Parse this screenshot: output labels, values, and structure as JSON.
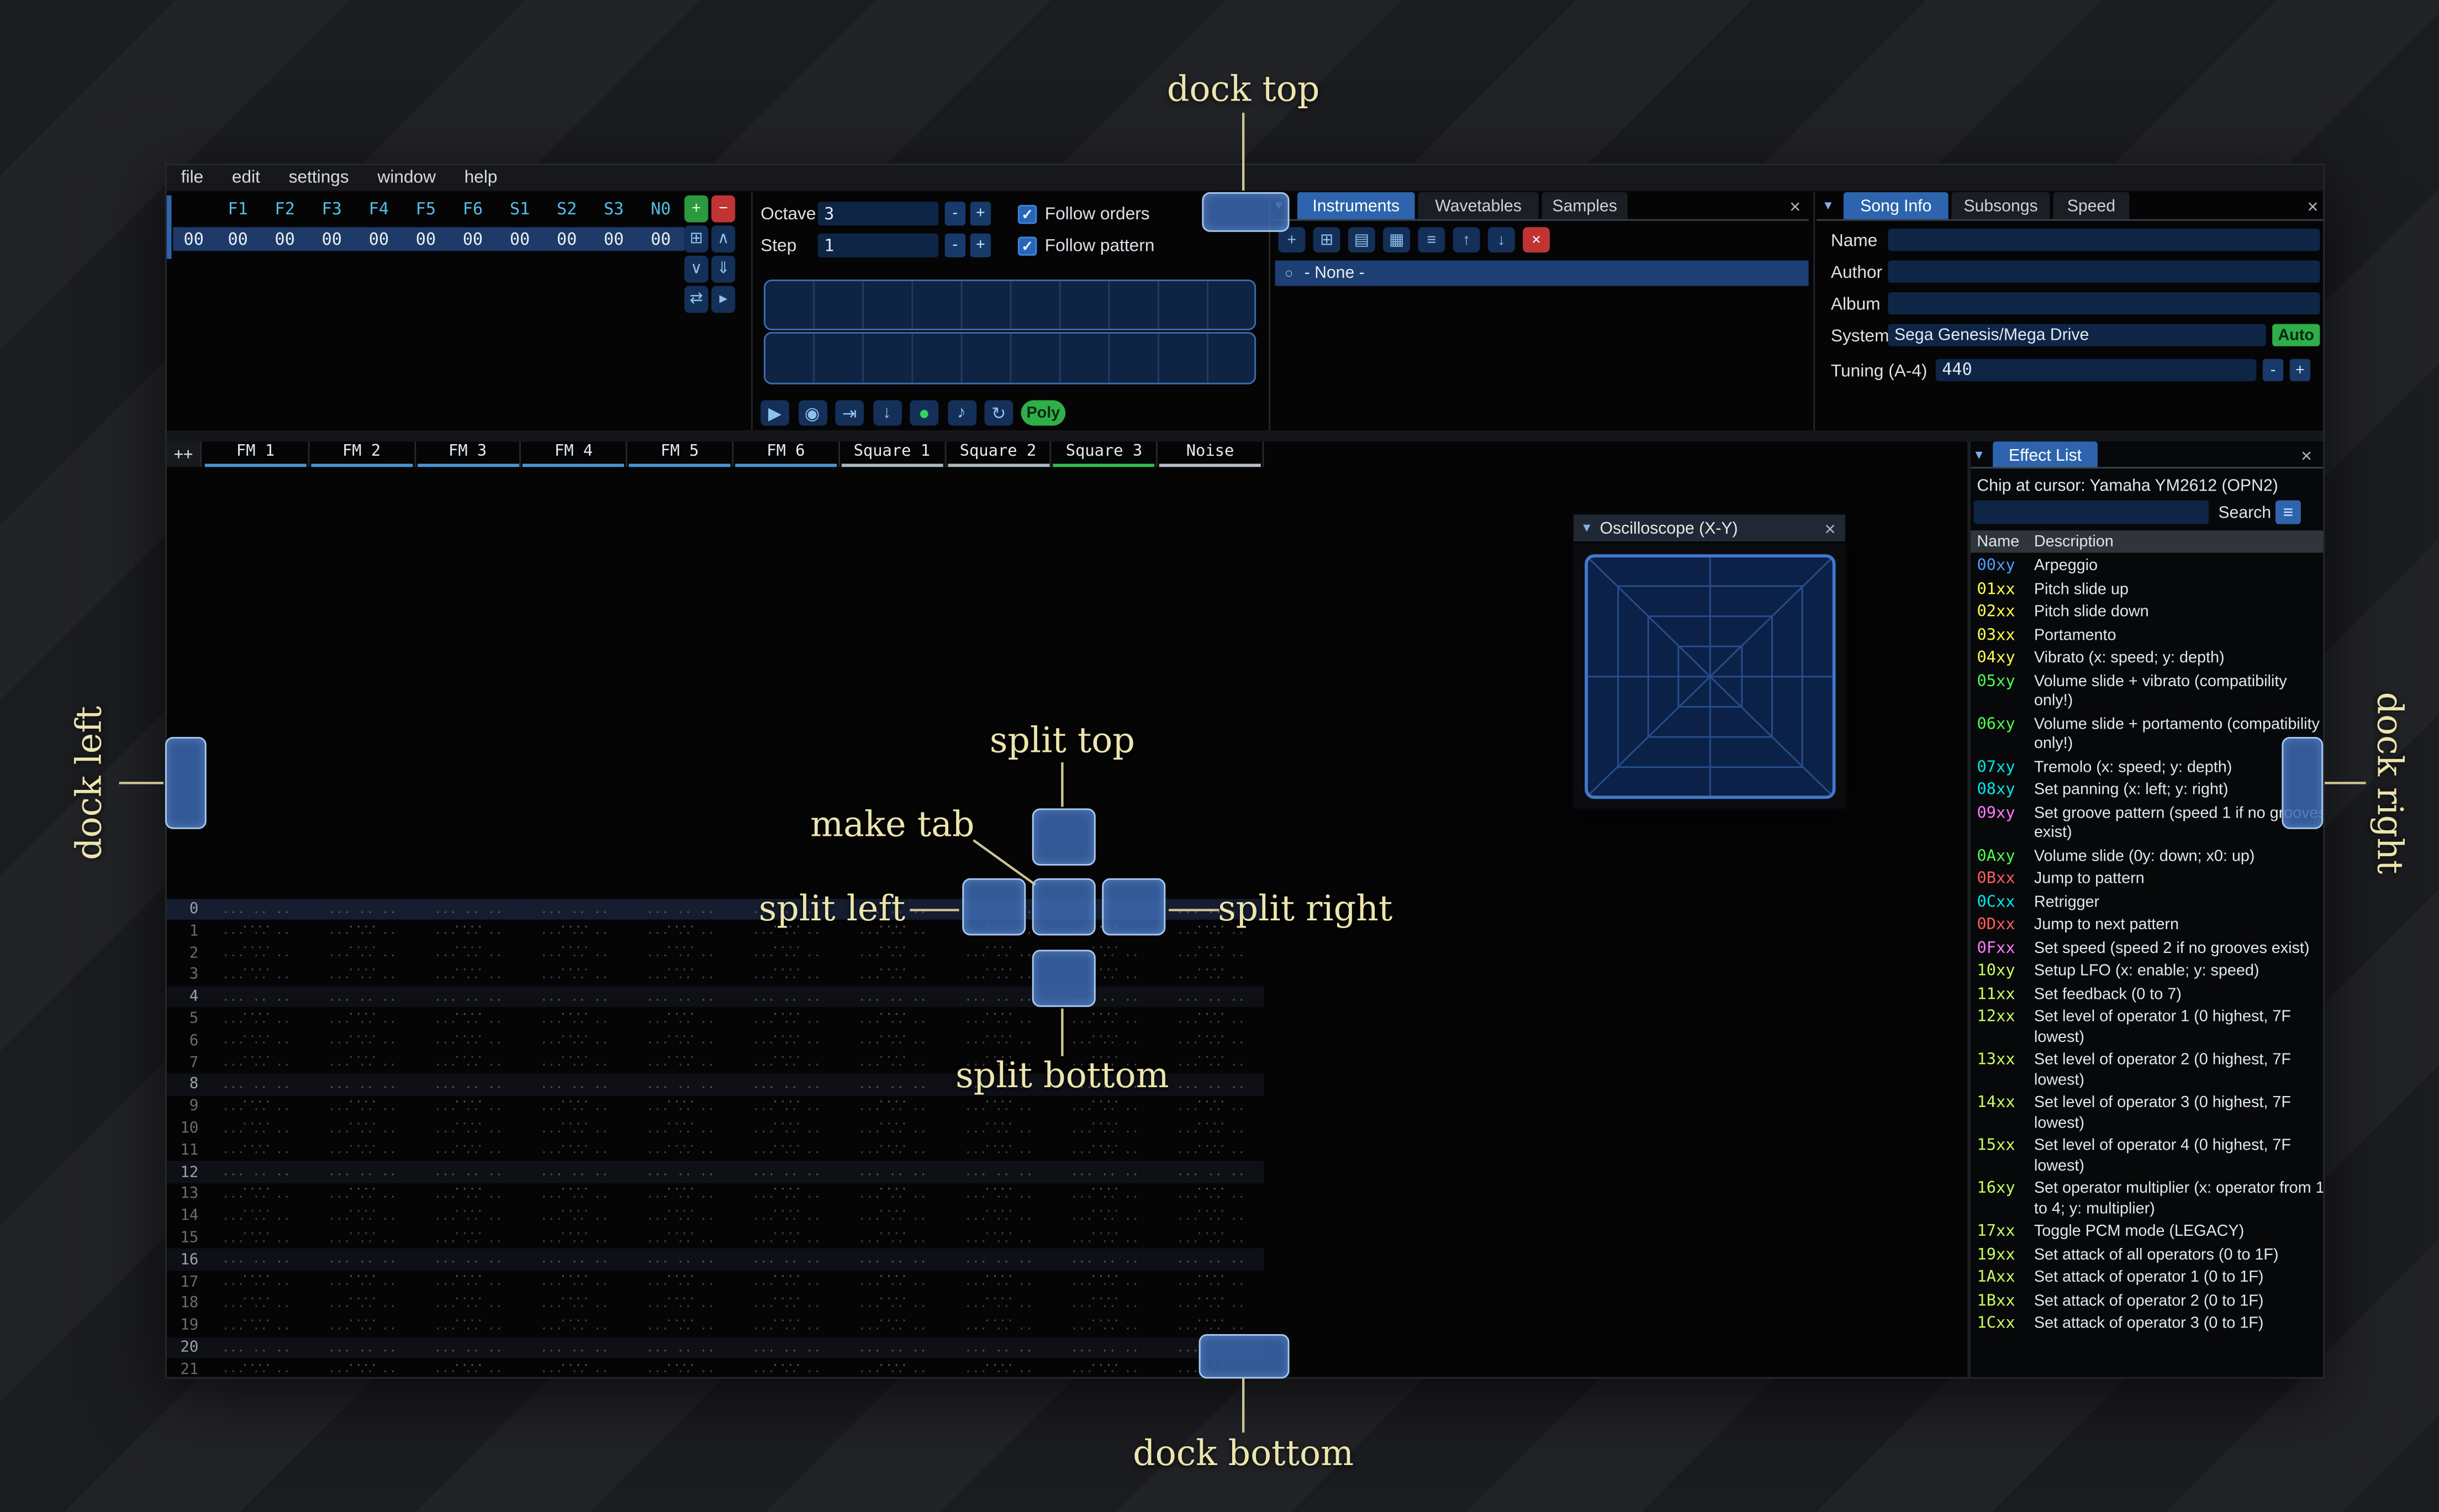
{
  "colors": {
    "accent": "#2d64ad",
    "overlay_label": "#ece5ad",
    "dock_fill": "#3c6ab2",
    "dock_border": "#a9c9f3"
  },
  "icons": {
    "check": "✓",
    "close": "×",
    "collapse": "▾",
    "radio": "○",
    "burger": "≡"
  },
  "menu": {
    "items": [
      "file",
      "edit",
      "settings",
      "window",
      "help"
    ]
  },
  "orders": {
    "row_index": "00",
    "columns": [
      "F1",
      "F2",
      "F3",
      "F4",
      "F5",
      "F6",
      "S1",
      "S2",
      "S3",
      "N0"
    ],
    "values": [
      "00",
      "00",
      "00",
      "00",
      "00",
      "00",
      "00",
      "00",
      "00",
      "00"
    ],
    "buttons": [
      {
        "name": "add-order",
        "glyph": "+",
        "style": "green"
      },
      {
        "name": "remove-order",
        "glyph": "−",
        "style": "red"
      },
      {
        "name": "duplicate-order",
        "glyph": "⊞",
        "style": "blue"
      },
      {
        "name": "move-order-up",
        "glyph": "∧",
        "style": "blue"
      },
      {
        "name": "move-order-down",
        "glyph": "∨",
        "style": "blue"
      },
      {
        "name": "duplicate-order-to-end",
        "glyph": "⇓",
        "style": "blue"
      },
      {
        "name": "order-change-all",
        "glyph": "⇄",
        "style": "blue"
      },
      {
        "name": "order-edit-mode",
        "glyph": "▸",
        "style": "blue"
      }
    ]
  },
  "controls": {
    "octave_label": "Octave",
    "octave_value": "3",
    "step_label": "Step",
    "step_value": "1",
    "minus": "-",
    "plus": "+",
    "follow_orders": "Follow orders",
    "follow_pattern": "Follow pattern",
    "play_buttons": [
      {
        "name": "play",
        "glyph": "▶"
      },
      {
        "name": "play-pattern",
        "glyph": "◉"
      },
      {
        "name": "play-from-cursor",
        "glyph": "⇥"
      },
      {
        "name": "step-one-row",
        "glyph": "↓"
      },
      {
        "name": "record",
        "glyph": "●",
        "style": "record"
      },
      {
        "name": "metronome",
        "glyph": "♪"
      },
      {
        "name": "repeat-pattern",
        "glyph": "↻"
      }
    ],
    "poly_label": "Poly"
  },
  "instrument_panel": {
    "tabs": [
      {
        "label": "Instruments",
        "active": true
      },
      {
        "label": "Wavetables",
        "active": false
      },
      {
        "label": "Samples",
        "active": false
      }
    ],
    "toolbar": [
      {
        "name": "add-instrument",
        "glyph": "+",
        "style": "blue"
      },
      {
        "name": "duplicate-instrument",
        "glyph": "⊞",
        "style": "blue"
      },
      {
        "name": "open-instrument",
        "glyph": "▤",
        "style": "blue"
      },
      {
        "name": "save-instrument",
        "glyph": "▦",
        "style": "blue"
      },
      {
        "name": "instrument-directory",
        "glyph": "≡",
        "style": "blue"
      },
      {
        "name": "move-instrument-up",
        "glyph": "↑",
        "style": "blue"
      },
      {
        "name": "move-instrument-down",
        "glyph": "↓",
        "style": "blue"
      },
      {
        "name": "delete-instrument",
        "glyph": "×",
        "style": "red"
      }
    ],
    "list_item": "- None -"
  },
  "song_info": {
    "tabs": [
      {
        "label": "Song Info",
        "active": true
      },
      {
        "label": "Subsongs",
        "active": false
      },
      {
        "label": "Speed",
        "active": false
      }
    ],
    "name_label": "Name",
    "name_value": "",
    "author_label": "Author",
    "author_value": "",
    "album_label": "Album",
    "album_value": "",
    "system_label": "System",
    "system_value": "Sega Genesis/Mega Drive",
    "auto_label": "Auto",
    "tuning_label": "Tuning (A-4)",
    "tuning_value": "440",
    "minus": "-",
    "plus": "+"
  },
  "pattern": {
    "add_channel_label": "++",
    "channels": [
      {
        "name": "FM 1",
        "color": "#4895d8"
      },
      {
        "name": "FM 2",
        "color": "#4895d8"
      },
      {
        "name": "FM 3",
        "color": "#4895d8"
      },
      {
        "name": "FM 4",
        "color": "#4895d8"
      },
      {
        "name": "FM 5",
        "color": "#4895d8"
      },
      {
        "name": "FM 6",
        "color": "#4895d8"
      },
      {
        "name": "Square 1",
        "color": "#aeb9bf"
      },
      {
        "name": "Square 2",
        "color": "#aeb9bf"
      },
      {
        "name": "Square 3",
        "color": "#2fbf4f"
      },
      {
        "name": "Noise",
        "color": "#b6bfc6"
      }
    ],
    "rows": [
      "0",
      "1",
      "2",
      "3",
      "4",
      "5",
      "6",
      "7",
      "8",
      "9",
      "10",
      "11",
      "12",
      "13",
      "14",
      "15",
      "16",
      "17",
      "18",
      "19",
      "20",
      "21"
    ],
    "empty_cell": "... .. .. ...."
  },
  "oscilloscope": {
    "title": "Oscilloscope (X-Y)"
  },
  "effect_list": {
    "title": "Effect List",
    "chip_line": "Chip at cursor: Yamaha YM2612 (OPN2)",
    "search_label": "Search",
    "search_value": "",
    "name_header": "Name",
    "description_header": "Description",
    "effects": [
      {
        "code": "00xy",
        "color": "#4d9fff",
        "desc": "Arpeggio"
      },
      {
        "code": "01xx",
        "color": "#fdff50",
        "desc": "Pitch slide up"
      },
      {
        "code": "02xx",
        "color": "#fdff50",
        "desc": "Pitch slide down"
      },
      {
        "code": "03xx",
        "color": "#fdff50",
        "desc": "Portamento"
      },
      {
        "code": "04xy",
        "color": "#fdff50",
        "desc": "Vibrato (x: speed; y: depth)"
      },
      {
        "code": "05xy",
        "color": "#4dff4d",
        "desc": "Volume slide + vibrato (compatibility only!)"
      },
      {
        "code": "06xy",
        "color": "#4dff4d",
        "desc": "Volume slide + portamento (compatibility only!)"
      },
      {
        "code": "07xy",
        "color": "#00e8e8",
        "desc": "Tremolo (x: speed; y: depth)"
      },
      {
        "code": "08xy",
        "color": "#00e8e8",
        "desc": "Set panning (x: left; y: right)"
      },
      {
        "code": "09xy",
        "color": "#ff79ff",
        "desc": "Set groove pattern (speed 1 if no grooves exist)"
      },
      {
        "code": "0Axy",
        "color": "#4dff4d",
        "desc": "Volume slide (0y: down; x0: up)"
      },
      {
        "code": "0Bxx",
        "color": "#ff5c5c",
        "desc": "Jump to pattern"
      },
      {
        "code": "0Cxx",
        "color": "#00e8e8",
        "desc": "Retrigger"
      },
      {
        "code": "0Dxx",
        "color": "#ff5c5c",
        "desc": "Jump to next pattern"
      },
      {
        "code": "0Fxx",
        "color": "#ff79ff",
        "desc": "Set speed (speed 2 if no grooves exist)"
      },
      {
        "code": "10xy",
        "color": "#c8ff5e",
        "desc": "Setup LFO (x: enable; y: speed)"
      },
      {
        "code": "11xx",
        "color": "#c8ff5e",
        "desc": "Set feedback (0 to 7)"
      },
      {
        "code": "12xx",
        "color": "#c8ff5e",
        "desc": "Set level of operator 1 (0 highest, 7F lowest)"
      },
      {
        "code": "13xx",
        "color": "#c8ff5e",
        "desc": "Set level of operator 2 (0 highest, 7F lowest)"
      },
      {
        "code": "14xx",
        "color": "#c8ff5e",
        "desc": "Set level of operator 3 (0 highest, 7F lowest)"
      },
      {
        "code": "15xx",
        "color": "#c8ff5e",
        "desc": "Set level of operator 4 (0 highest, 7F lowest)"
      },
      {
        "code": "16xy",
        "color": "#c8ff5e",
        "desc": "Set operator multiplier (x: operator from 1 to 4; y: multiplier)"
      },
      {
        "code": "17xx",
        "color": "#c8ff5e",
        "desc": "Toggle PCM mode (LEGACY)"
      },
      {
        "code": "19xx",
        "color": "#c8ff5e",
        "desc": "Set attack of all operators (0 to 1F)"
      },
      {
        "code": "1Axx",
        "color": "#c8ff5e",
        "desc": "Set attack of operator 1 (0 to 1F)"
      },
      {
        "code": "1Bxx",
        "color": "#c8ff5e",
        "desc": "Set attack of operator 2 (0 to 1F)"
      },
      {
        "code": "1Cxx",
        "color": "#c8ff5e",
        "desc": "Set attack of operator 3 (0 to 1F)"
      }
    ]
  },
  "overlay": {
    "dock_top": "dock top",
    "dock_bottom": "dock bottom",
    "dock_left": "dock left",
    "dock_right": "dock right",
    "split_top": "split top",
    "split_bottom": "split bottom",
    "split_left": "split left",
    "split_right": "split right",
    "make_tab": "make tab"
  }
}
